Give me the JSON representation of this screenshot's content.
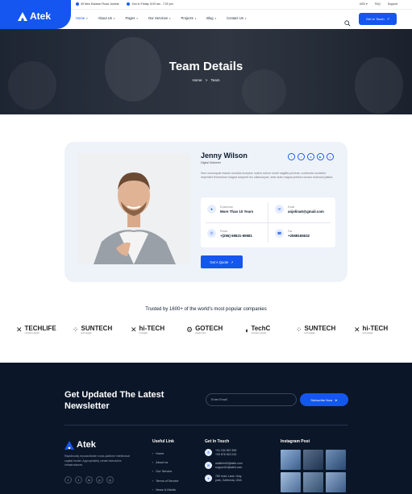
{
  "topbar": {
    "address": "45 New Eskaton Road, Austria",
    "hours": "Sun to Friday: 8:00 am - 7:00 pm",
    "currency": "USD",
    "faq": "FAQ",
    "support": "Support"
  },
  "brand": {
    "name": "Atek"
  },
  "nav": {
    "items": [
      {
        "label": "Home",
        "has_dropdown": true,
        "active": true
      },
      {
        "label": "About Us",
        "has_dropdown": true
      },
      {
        "label": "Pages",
        "has_dropdown": true
      },
      {
        "label": "Our Services",
        "has_dropdown": true
      },
      {
        "label": "Projects",
        "has_dropdown": true
      },
      {
        "label": "Blog",
        "has_dropdown": true
      },
      {
        "label": "Contact Us",
        "has_dropdown": true
      }
    ],
    "cta": "Get In Touch"
  },
  "hero": {
    "title": "Team Details",
    "breadcrumb_home": "Home",
    "breadcrumb_sep": ">",
    "breadcrumb_current": "Team"
  },
  "profile": {
    "name": "Jenny Wilson",
    "role": "Digital Marketer",
    "bio": "Sem consequat mauris conubia inceptos nostra rutrum morbi sagittis pulvinar, commodo curabitur imperdiet fermentum magna torquent leo ullamcorper, ante aute magna pretium cursus euismod platea.",
    "experience_label": "Experience",
    "experience_value": "More Than 10 Years",
    "email_label": "Email",
    "email_value": "anjelina5@gmail.com",
    "phone_label": "Phone",
    "phone_value": "+(256) 58621-69581",
    "fax_label": "Fax",
    "fax_value": "+2568165632",
    "quote_button": "Get A Quote"
  },
  "trusted": {
    "title": "Trusted by 1600+ of the world's most popular companies",
    "brands": [
      {
        "name": "TECHLIFE",
        "tag": "company digital"
      },
      {
        "name": "SUNTECH",
        "tag": "tech slogan"
      },
      {
        "name": "hi-TECH",
        "tag": "hi slogan"
      },
      {
        "name": "GOTECH",
        "tag": "slogan here"
      },
      {
        "name": "TechC",
        "tag": "company slogan"
      },
      {
        "name": "SUNTECH",
        "tag": "tech slogan"
      },
      {
        "name": "hi-TECH",
        "tag": "tech slogan"
      }
    ]
  },
  "footer": {
    "newsletter_title": "Get Updated The Latest Newsletter",
    "email_placeholder": "Enter Email",
    "subscribe": "Subscribe Now",
    "description": "Rapidiously myocardinate cross-platform intellectual capital model. Appropriately create interactive infrastructures",
    "useful_link_title": "Useful Link",
    "useful_links": [
      "Home",
      "About us",
      "Our Service",
      "Terms of Service",
      "News & Media"
    ],
    "get_in_touch_title": "Get In Touch",
    "phones": [
      "+01 234 567 890",
      "+09 876 543 210"
    ],
    "emails": [
      "mailinfo00@atek.com",
      "support24@atek.com"
    ],
    "address": "789 Inner Lane, Holy park, California, USA",
    "instagram_title": "Instagram Post"
  },
  "colors": {
    "accent": "#1556f0",
    "footer_bg": "#0b1728",
    "card_bg": "#eef2f9"
  }
}
